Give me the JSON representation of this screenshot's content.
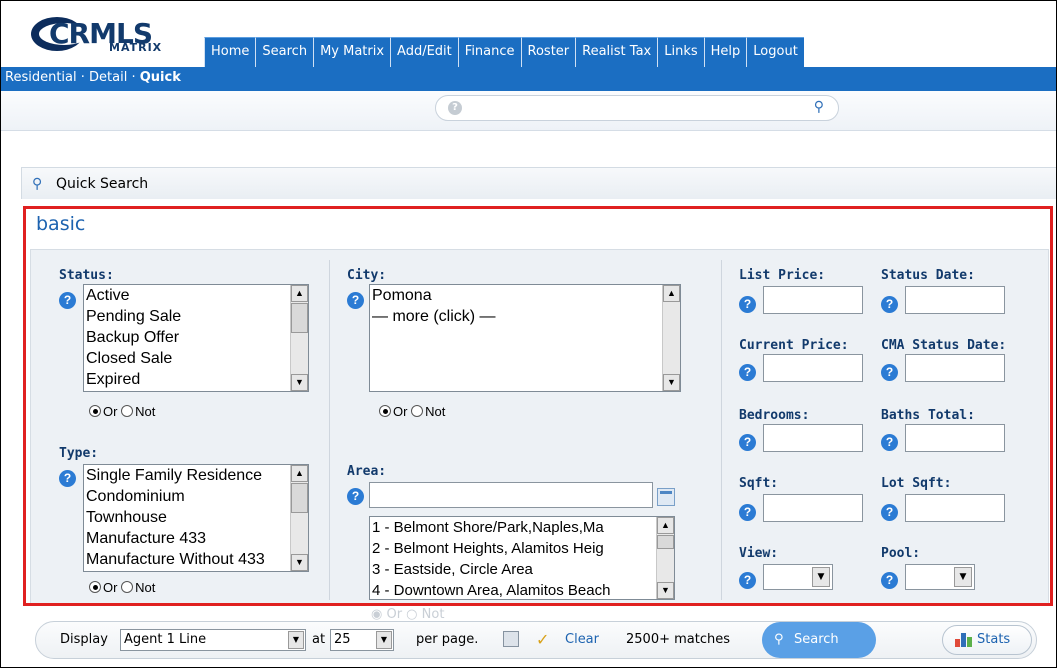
{
  "header": {
    "logo_main": "CRMLS",
    "logo_sub": "MATRIX",
    "nav": [
      "Home",
      "Search",
      "My Matrix",
      "Add/Edit",
      "Finance",
      "Roster",
      "Realist Tax",
      "Links",
      "Help",
      "Logout"
    ]
  },
  "breadcrumb": {
    "item1": "Residential",
    "sep": "·",
    "item2": "Detail",
    "item3": "Quick"
  },
  "quick_search": {
    "title": "Quick Search",
    "section": "basic",
    "status": {
      "label": "Status:",
      "options": [
        "Active",
        "Pending Sale",
        "Backup Offer",
        "Closed Sale",
        "Expired"
      ]
    },
    "type": {
      "label": "Type:",
      "options": [
        "Single Family Residence",
        "Condominium",
        "Townhouse",
        "Manufacture 433",
        "Manufacture Without 433"
      ]
    },
    "or_label": "Or",
    "not_label": "Not",
    "city": {
      "label": "City:",
      "options": [
        "Pomona",
        "— more (click) —"
      ]
    },
    "area": {
      "label": "Area:",
      "input_value": "",
      "options": [
        "1 - Belmont Shore/Park,Naples,Ma",
        "2 - Belmont Heights, Alamitos Heig",
        "3 - Eastside, Circle Area",
        "4 - Downtown Area, Alamitos Beach"
      ]
    },
    "fields": {
      "list_price": "List Price:",
      "status_date": "Status Date:",
      "current_price": "Current Price:",
      "cma_status_date": "CMA Status Date:",
      "bedrooms": "Bedrooms:",
      "baths_total": "Baths Total:",
      "sqft": "Sqft:",
      "lot_sqft": "Lot Sqft:",
      "view": "View:",
      "pool": "Pool:"
    }
  },
  "bottom_bar": {
    "display_label": "Display",
    "display_value": "Agent 1 Line",
    "at_label": "at",
    "per_page_value": "25",
    "per_page_label": "per page.",
    "clear_label": "Clear",
    "matches": "2500+ matches",
    "search_label": "Search",
    "stats_label": "Stats"
  },
  "colors": {
    "nav_blue": "#1b6ec2",
    "highlight_red": "#e02020",
    "label_navy": "#123a6c",
    "link_blue": "#1d63b0"
  }
}
